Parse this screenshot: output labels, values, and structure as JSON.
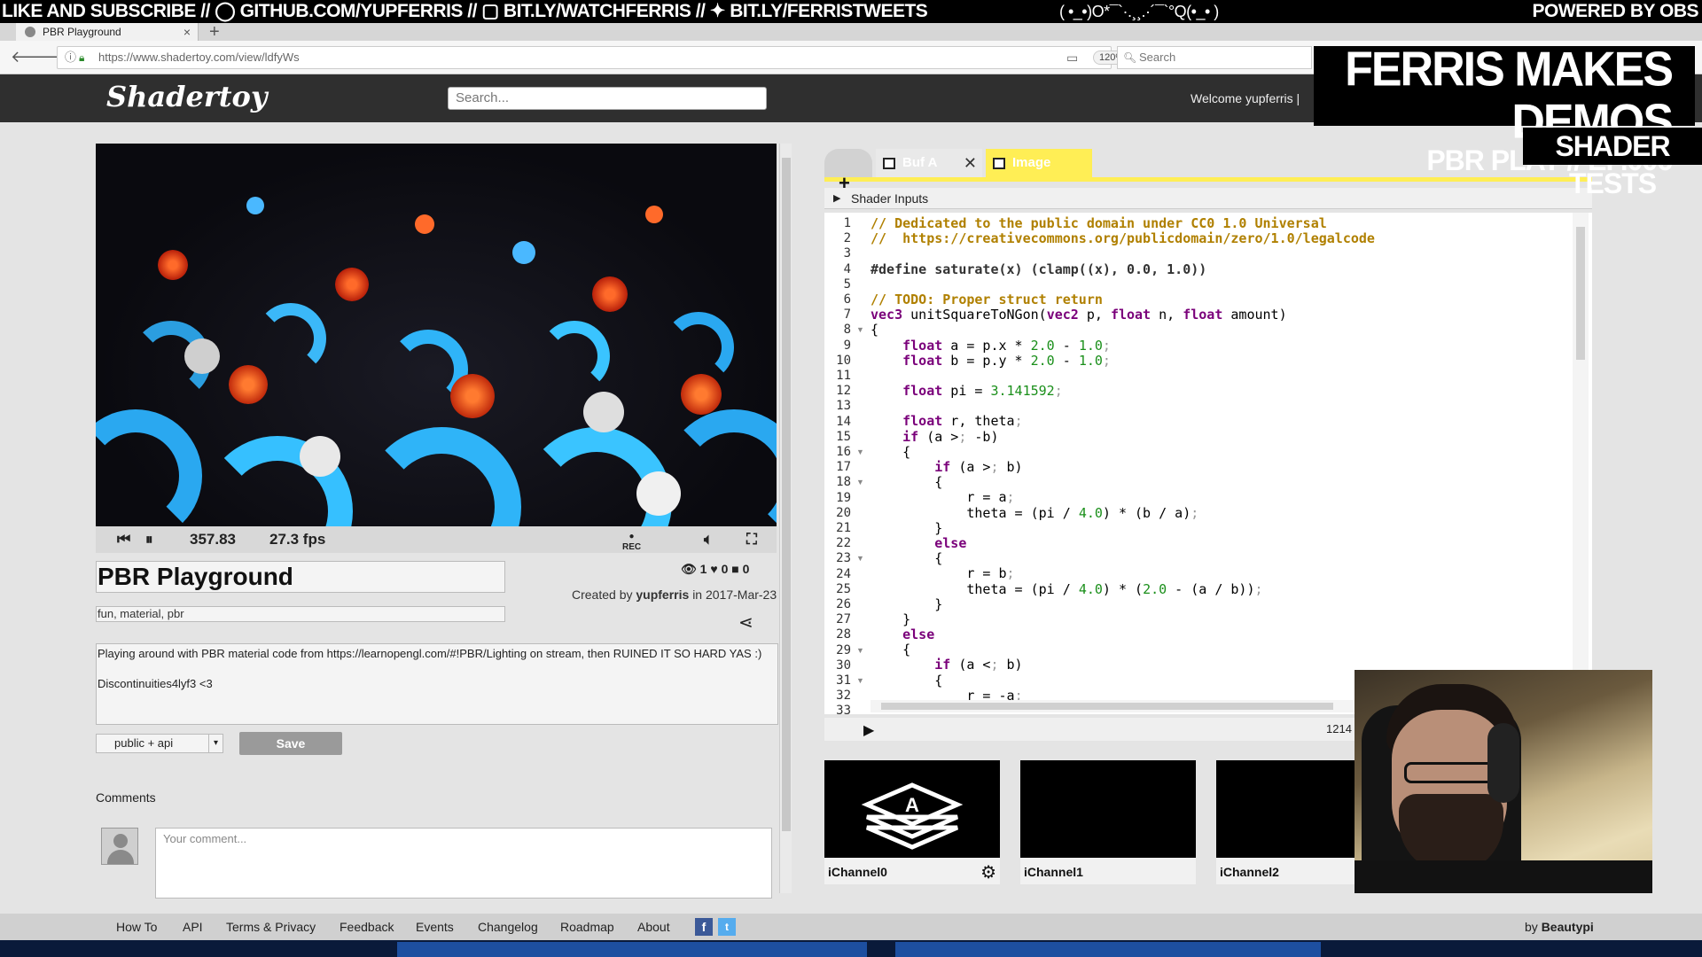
{
  "stream_overlay": {
    "top_left": "LIKE AND SUBSCRIBE // ◯ GITHUB.COM/YUPFERRIS // ▢ BIT.LY/WATCHFERRIS // ✦ BIT.LY/FERRISTWEETS",
    "top_mid": "( •_•)O*¯`·.¸¸.·´¯`°Q(•_• )",
    "top_right": "POWERED BY OBS",
    "title_line1": "FERRIS MAKES DEMOS",
    "title_line2": "PBR PLAY // EP.006",
    "badge": "SHADER TESTS"
  },
  "browser": {
    "tab_title": "PBR Playground",
    "url": "https://www.shadertoy.com/view/ldfyWs",
    "zoom": "120%",
    "search_placeholder": "Search"
  },
  "site": {
    "logo": "Shadertoy",
    "search_placeholder": "Search...",
    "welcome": "Welcome yupferris |"
  },
  "player": {
    "time": "357.83",
    "fps": "27.3 fps",
    "rec_label": "REC"
  },
  "shader": {
    "title": "PBR Playground",
    "views": "1",
    "likes": "0",
    "comments_count": "0",
    "created_prefix": "Created by",
    "author": "yupferris",
    "created_suffix": "in 2017-Mar-23",
    "tags": "fun, material, pbr",
    "description_line1": "Playing around with PBR material code from https://learnopengl.com/#!PBR/Lighting on stream, then RUINED IT SO HARD YAS :)",
    "description_line2": "Discontinuities4lyf3 <3",
    "visibility": "public + api",
    "save_label": "Save"
  },
  "comments": {
    "label": "Comments",
    "placeholder": "Your comment..."
  },
  "editor": {
    "tab_buffer": "Buf A",
    "tab_image": "Image",
    "shader_inputs_label": "Shader Inputs",
    "char_count": "1214",
    "lines": [
      "// Dedicated to the public domain under CC0 1.0 Universal",
      "//  https://creativecommons.org/publicdomain/zero/1.0/legalcode",
      "",
      "#define saturate(x) (clamp((x), 0.0, 1.0))",
      "",
      "// TODO: Proper struct return",
      "vec3 unitSquareToNGon(vec2 p, float n, float amount)",
      "{",
      "    float a = p.x * 2.0 - 1.0;",
      "    float b = p.y * 2.0 - 1.0;",
      "",
      "    float pi = 3.141592;",
      "",
      "    float r, theta;",
      "    if (a > -b)",
      "    {",
      "        if (a > b)",
      "        {",
      "            r = a;",
      "            theta = (pi / 4.0) * (b / a);",
      "        }",
      "        else",
      "        {",
      "            r = b;",
      "            theta = (pi / 4.0) * (2.0 - (a / b));",
      "        }",
      "    }",
      "    else",
      "    {",
      "        if (a < b)",
      "        {",
      "            r = -a;",
      ""
    ],
    "line_numbers": [
      "1",
      "2",
      "3",
      "4",
      "5",
      "6",
      "7",
      "8",
      "9",
      "10",
      "11",
      "12",
      "13",
      "14",
      "15",
      "16",
      "17",
      "18",
      "19",
      "20",
      "21",
      "22",
      "23",
      "24",
      "25",
      "26",
      "27",
      "28",
      "29",
      "30",
      "31",
      "32",
      "33"
    ],
    "channels": [
      "iChannel0",
      "iChannel1",
      "iChannel2"
    ]
  },
  "footer": {
    "links": [
      "How To",
      "API",
      "Terms & Privacy",
      "Feedback",
      "Events",
      "Changelog",
      "Roadmap",
      "About"
    ],
    "by_prefix": "by",
    "by_name": "Beautypi"
  },
  "colors": {
    "header_bg": "#2f2f2f",
    "image_tab": "#ffee55",
    "comment": "#b08000",
    "keyword": "#7a007a",
    "number": "#1a8f1a",
    "save_button": "#9a9a9a"
  }
}
